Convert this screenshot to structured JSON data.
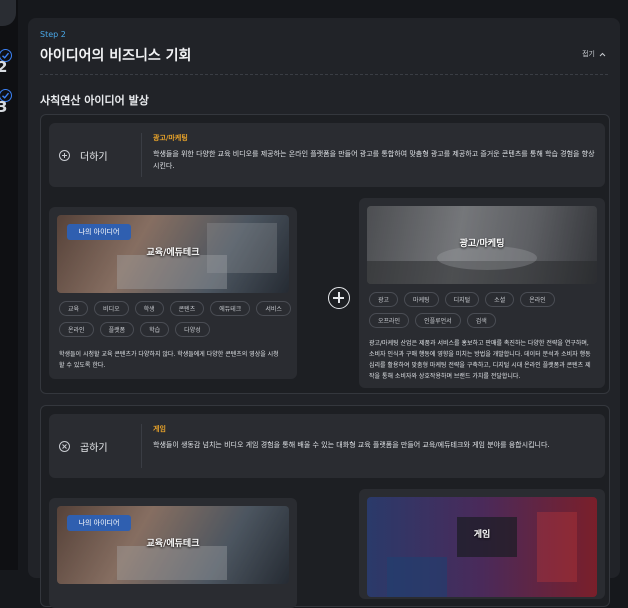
{
  "rail": {
    "step_numbers": [
      "2",
      "3"
    ]
  },
  "header": {
    "step_label": "Step 2",
    "title": "아이디어의 비즈니스 기회",
    "fold_label": "접기"
  },
  "section": {
    "title": "사칙연산 아이디어 발상"
  },
  "blocks": [
    {
      "operation": "더하기",
      "combo_category": "광고/마케팅",
      "combo_desc": "학생들을 위한 다양한 교육 비디오를 제공하는 온라인 플랫폼을 만들어 광고를 통합하여 맞춤형 광고를 제공하고 즐거운 콘텐츠를 통해 학습 경험을 향상시킨다.",
      "left_card": {
        "badge": "나의 아이디어",
        "image_label": "교육/에듀테크",
        "tags": [
          "교육",
          "비디오",
          "학생",
          "콘텐츠",
          "에듀테크",
          "서비스",
          "온라인",
          "플랫폼",
          "학습",
          "다양성"
        ],
        "desc_lines": [
          "학생들이 시청할 교육 콘텐츠가 다양하지 않다. 학생들에게 다양한 콘텐츠의 영상을 시청",
          "할 수 있도록 한다."
        ]
      },
      "right_card": {
        "image_label": "광고/마케팅",
        "tags": [
          "광고",
          "마케팅",
          "디지털",
          "소셜",
          "온라인",
          "오프라인",
          "인플루언서",
          "검색"
        ],
        "desc_lines": [
          "광고/마케팅 산업은 제품과 서비스를 홍보하고 판매를 촉진하는 다양한 전략을 연구하며,",
          "소비자 인식과 구매 행동에 영향을 미치는 방법을 개발합니다. 데이터 분석과 소비자 행동",
          "심리를 활용하여 맞춤형 마케팅 전략을 구축하고, 디지털 시대 온라인 플랫폼과 콘텐츠 제",
          "작을 통해 소비자와 상호작용하며 브랜드 가치를 전달합니다."
        ]
      }
    },
    {
      "operation": "곱하기",
      "combo_category": "게임",
      "combo_desc": "학생들이 생동감 넘치는 비디오 게임 경험을 통해 배울 수 있는 대화형 교육 플랫폼을 만들어 교육/에듀테크와 게임 분야를 융합시킵니다.",
      "left_card": {
        "badge": "나의 아이디어",
        "image_label": "교육/에듀테크"
      },
      "right_card": {
        "image_label": "게임"
      }
    }
  ],
  "colors": {
    "accent_blue": "#3b82f6",
    "category_orange": "#e8a32a",
    "badge_blue": "#2f5fb0"
  }
}
